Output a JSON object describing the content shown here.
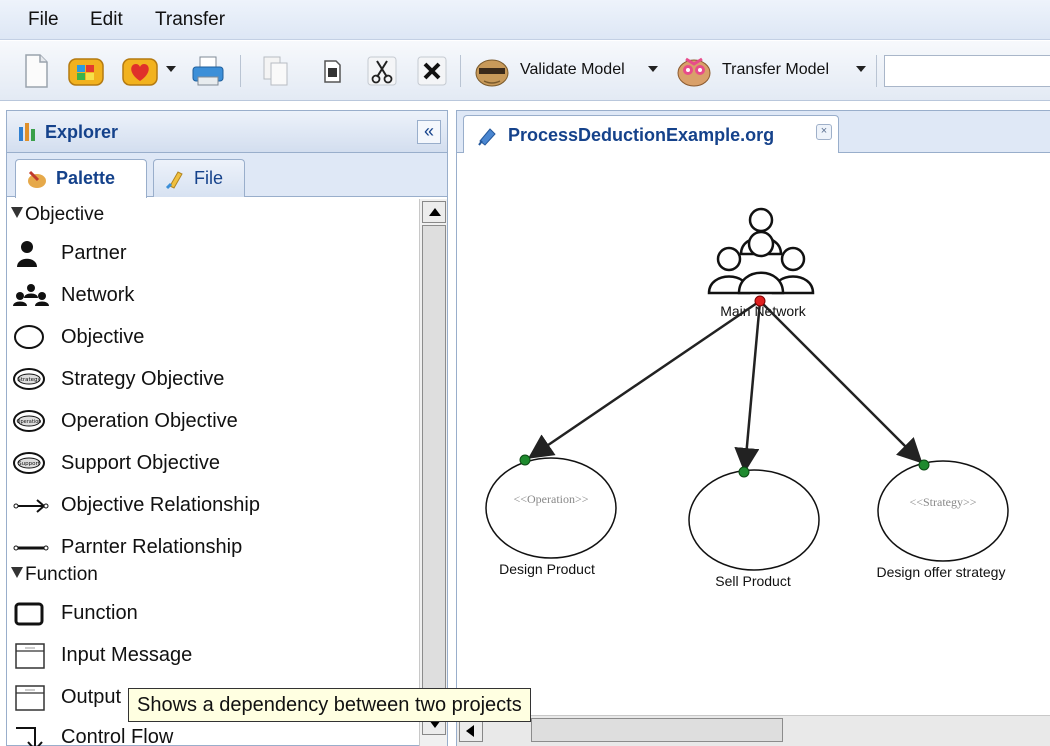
{
  "menubar": {
    "items": [
      "File",
      "Edit",
      "Transfer"
    ]
  },
  "toolbar": {
    "icons": [
      "new-document-icon",
      "palette-box-icon",
      "favorite-heart-icon",
      "print-icon",
      "copy-icon",
      "paste-icon",
      "cut-icon",
      "delete-icon"
    ],
    "validate_label": "Validate Model",
    "transfer_label": "Transfer Model",
    "search_value": ""
  },
  "explorer": {
    "title": "Explorer",
    "collapse_glyph": "«",
    "tabs": [
      {
        "label": "Palette",
        "active": true
      },
      {
        "label": "File",
        "active": false
      }
    ]
  },
  "palette": {
    "groups": [
      {
        "name": "Objective",
        "items": [
          {
            "label": "Partner",
            "icon": "partner-icon"
          },
          {
            "label": "Network",
            "icon": "network-icon"
          },
          {
            "label": "Objective",
            "icon": "ellipse-icon"
          },
          {
            "label": "Strategy Objective",
            "icon": "strategy-objective-icon",
            "icon_text": "Strategy"
          },
          {
            "label": "Operation Objective",
            "icon": "operation-objective-icon",
            "icon_text": "Operation"
          },
          {
            "label": "Support Objective",
            "icon": "support-objective-icon",
            "icon_text": "Support"
          },
          {
            "label": "Objective Relationship",
            "icon": "objective-relationship-icon"
          },
          {
            "label": "Parnter Relationship",
            "icon": "partner-relationship-icon"
          }
        ]
      },
      {
        "name": "Function",
        "items": [
          {
            "label": "Function",
            "icon": "function-icon"
          },
          {
            "label": "Input Message",
            "icon": "input-message-icon"
          },
          {
            "label": "Output",
            "icon": "output-message-icon"
          },
          {
            "label": "Control Flow",
            "icon": "control-flow-icon"
          }
        ]
      }
    ]
  },
  "editor": {
    "tab_title": "ProcessDeductionExample.org",
    "close_glyph": "×"
  },
  "diagram": {
    "network": {
      "label": "Main Network"
    },
    "objectives": [
      {
        "label": "Design Product",
        "stereotype": "<<Operation>>"
      },
      {
        "label": "Sell Product",
        "stereotype": ""
      },
      {
        "label": "Design offer strategy",
        "stereotype": "<<Strategy>>"
      }
    ],
    "colors": {
      "anchor_source": "#e02020",
      "anchor_target": "#1e8a2e",
      "edge": "#222222"
    }
  },
  "tooltip": {
    "text": "Shows a dependency between two projects"
  }
}
